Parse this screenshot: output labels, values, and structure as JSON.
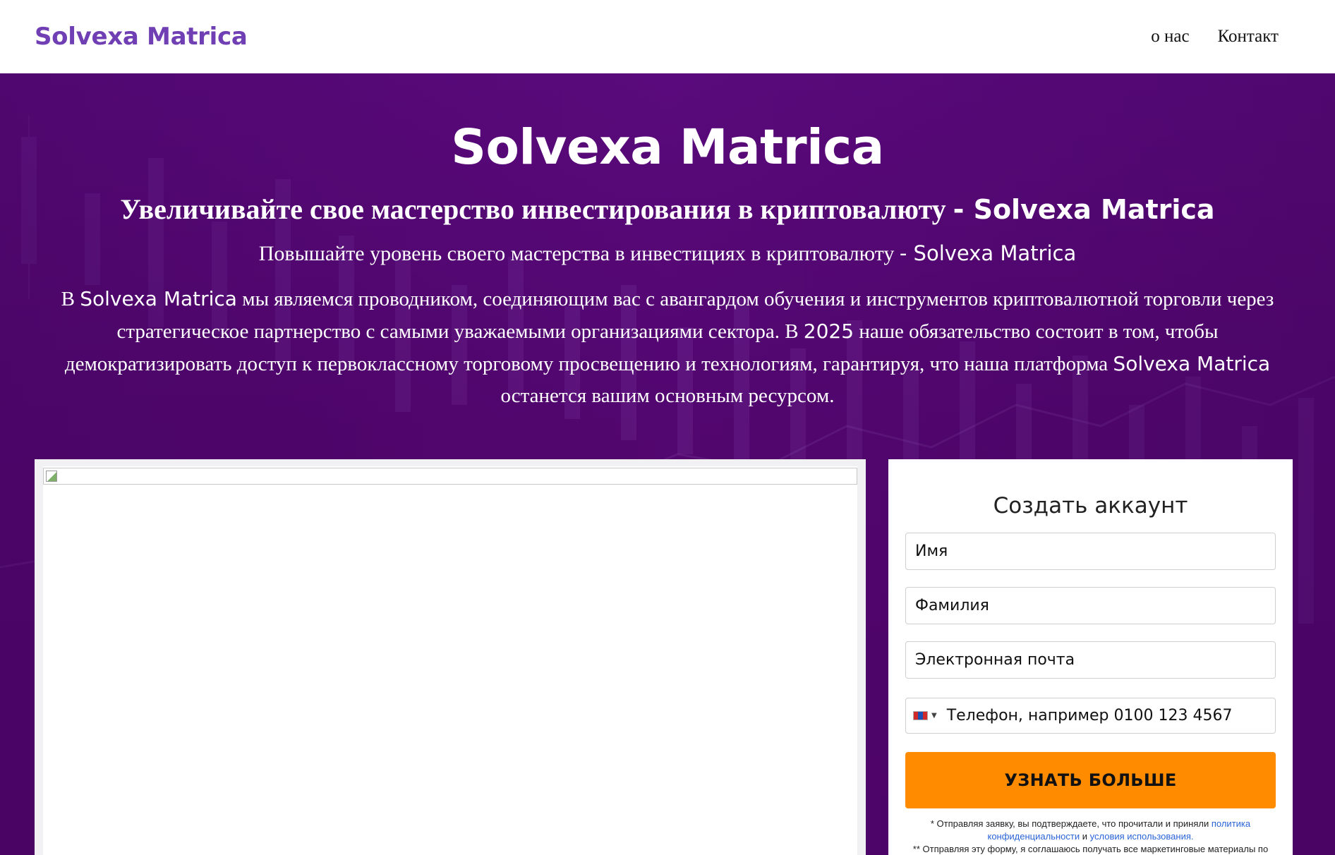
{
  "header": {
    "brand": "Solvexa Matrica",
    "nav": [
      {
        "label": "о нас"
      },
      {
        "label": "Контакт"
      }
    ]
  },
  "hero": {
    "title": "Solvexa Matrica",
    "subtitle_ru": "Увеличивайте свое мастерство инвестирования в криптовалюту",
    "subtitle_brand": "- Solvexa Matrica",
    "subtitle2_ru": "Повышайте уровень своего мастерства в инвестициях в криптовалюту",
    "subtitle2_brand": "- Solvexa Matrica",
    "para": {
      "p1": "В",
      "brand1": "Solvexa Matrica",
      "p2": "мы являемся проводником, соединяющим вас с авангардом обучения и инструментов криптовалютной торговли через стратегическое партнерство с самыми уважаемыми организациями сектора. В",
      "year": "2025",
      "p3": "наше обязательство состоит в том, чтобы демократизировать доступ к первоклассному торговому просвещению и технологиям, гарантируя, что наша платформа",
      "brand2": "Solvexa Matrica",
      "p4": "останется вашим основным ресурсом."
    }
  },
  "form": {
    "title": "Создать аккаунт",
    "first_name": "Имя",
    "last_name": "Фамилия",
    "email": "Электронная почта",
    "phone": "Телефон, например 0100 123 4567",
    "phone_flag_icon": "flag-mongolia-icon",
    "submit": "УЗНАТЬ БОЛЬШЕ",
    "legal": {
      "line1_prefix": "* Отправляя заявку, вы подтверждаете, что прочитали и приняли",
      "privacy_link": "политика конфиденциальности",
      "and": "и",
      "terms_link": "условия использования.",
      "line2": "** Отправляя эту форму, я соглашаюсь получать все маркетинговые материалы по"
    }
  },
  "colors": {
    "brand": "#6f3fb3",
    "hero_bg": "#52066f",
    "cta": "#ff8c00",
    "link": "#2a64d6"
  }
}
